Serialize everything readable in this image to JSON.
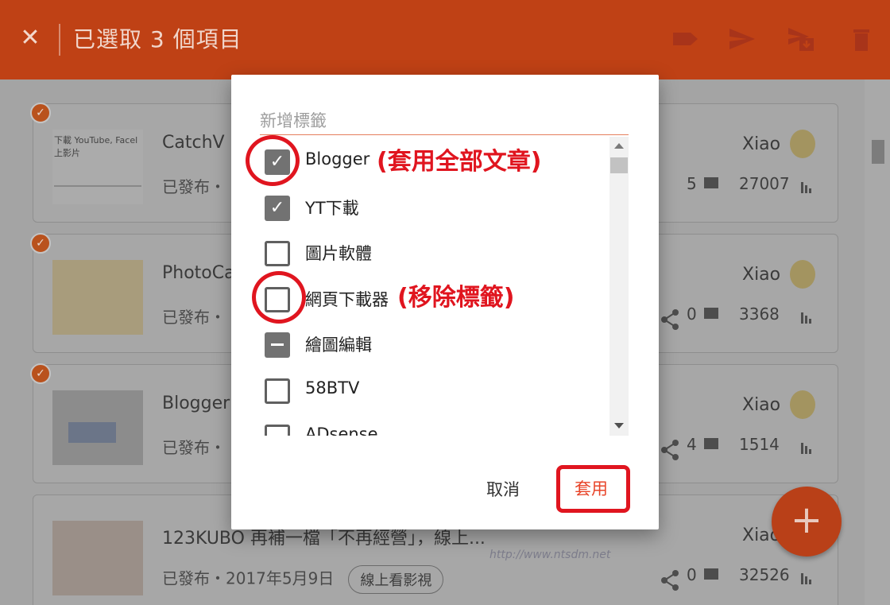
{
  "app_bar": {
    "title": "已選取 3 個項目",
    "actions": [
      "label-icon",
      "send-icon",
      "save-draft-icon",
      "trash-icon"
    ]
  },
  "posts": [
    {
      "title": "CatchV",
      "thumb_text": "下載 YouTube, Facel\n上影片",
      "status": "已發布・",
      "comments": "5",
      "views": "27007",
      "author": "Xiao"
    },
    {
      "title": "PhotoCa",
      "status": "已發布・",
      "comments": "0",
      "views": "3368",
      "author": "Xiao"
    },
    {
      "title": "Blogger",
      "status": "已發布・",
      "comments": "4",
      "views": "1514",
      "author": "Xiao"
    },
    {
      "title": "123KUBO 再補一檔「不再經營」，線上...",
      "status": "已發布・2017年5月9日",
      "watch_button": "線上看影視",
      "comments": "0",
      "views": "32526",
      "author": "Xiao"
    }
  ],
  "dialog": {
    "input_placeholder": "新增標籤",
    "labels": [
      {
        "name": "Blogger",
        "state": "checked"
      },
      {
        "name": "YT下載",
        "state": "checked"
      },
      {
        "name": "圖片軟體",
        "state": "unchecked"
      },
      {
        "name": "網頁下載器",
        "state": "unchecked"
      },
      {
        "name": "繪圖編輯",
        "state": "indeterminate"
      },
      {
        "name": "58BTV",
        "state": "unchecked"
      },
      {
        "name": "ADsense",
        "state": "unchecked"
      }
    ],
    "cancel_label": "取消",
    "apply_label": "套用"
  },
  "annotations": {
    "apply_all": "(套用全部文章)",
    "remove_label": "(移除標籤)"
  },
  "fab_label": "+",
  "watermark": "http://www.ntsdm.net",
  "colors": {
    "app_bar": "#bf4115",
    "accent": "#e8452a",
    "annotation": "#e0151f"
  }
}
